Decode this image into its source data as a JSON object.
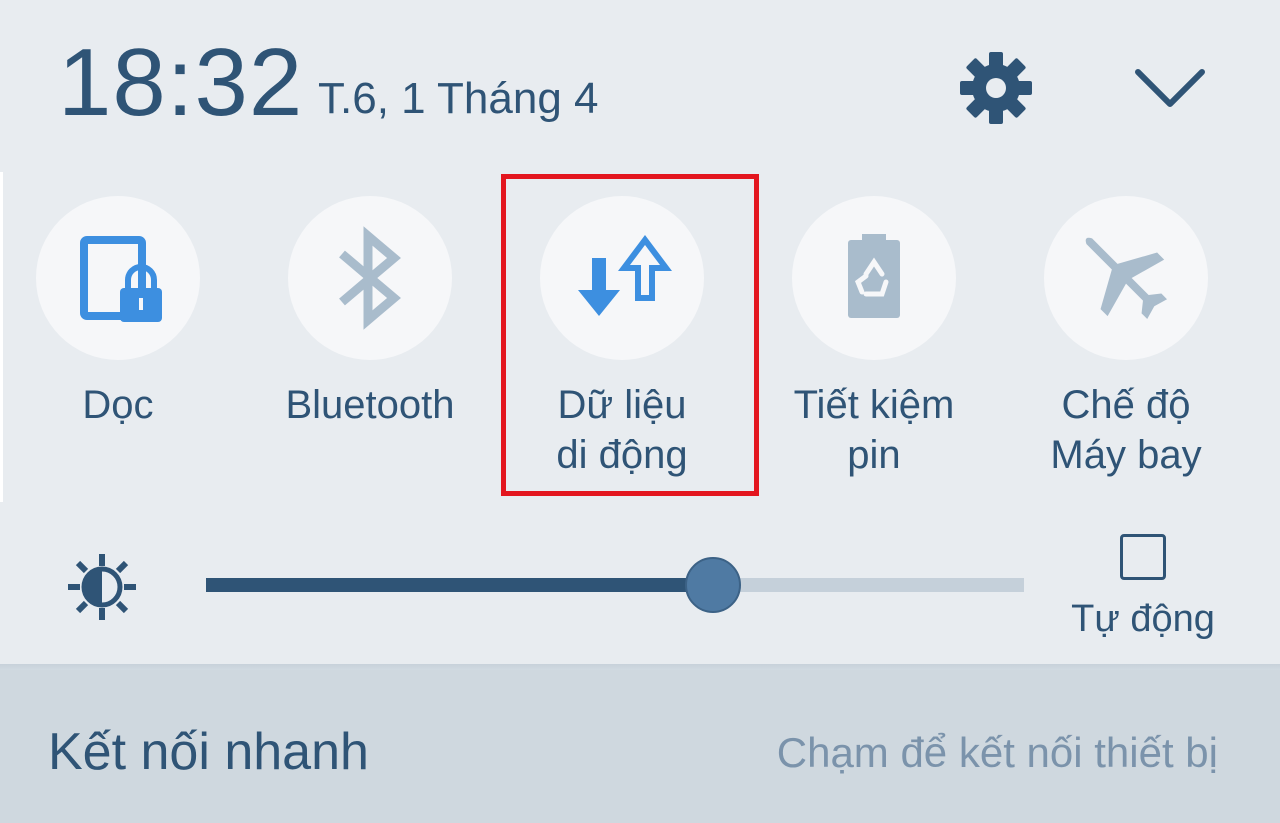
{
  "header": {
    "time": "18:32",
    "date": "T.6, 1 Tháng 4",
    "settings_icon": "gear-icon",
    "expand_icon": "chevron-down-icon"
  },
  "tiles": [
    {
      "label": "Dọc",
      "icon": "rotation-lock-icon",
      "active": true
    },
    {
      "label": "Bluetooth",
      "icon": "bluetooth-icon",
      "active": false
    },
    {
      "label_line1": "Dữ liệu",
      "label_line2": "di động",
      "icon": "mobile-data-icon",
      "active": true
    },
    {
      "label_line1": "Tiết kiệm",
      "label_line2": "pin",
      "icon": "battery-saver-icon",
      "active": false
    },
    {
      "label_line1": "Chế độ",
      "label_line2": "Máy bay",
      "icon": "airplane-icon",
      "active": false
    }
  ],
  "brightness": {
    "icon": "brightness-icon",
    "level_percent": 62,
    "auto_label": "Tự động",
    "auto_checked": false
  },
  "quick_connect": {
    "title": "Kết nối nhanh",
    "hint": "Chạm để kết nối thiết bị"
  },
  "colors": {
    "text_primary": "#2f5476",
    "active_icon": "#3d8fe0",
    "inactive_icon": "#a9bccc",
    "highlight": "#e3161f"
  }
}
